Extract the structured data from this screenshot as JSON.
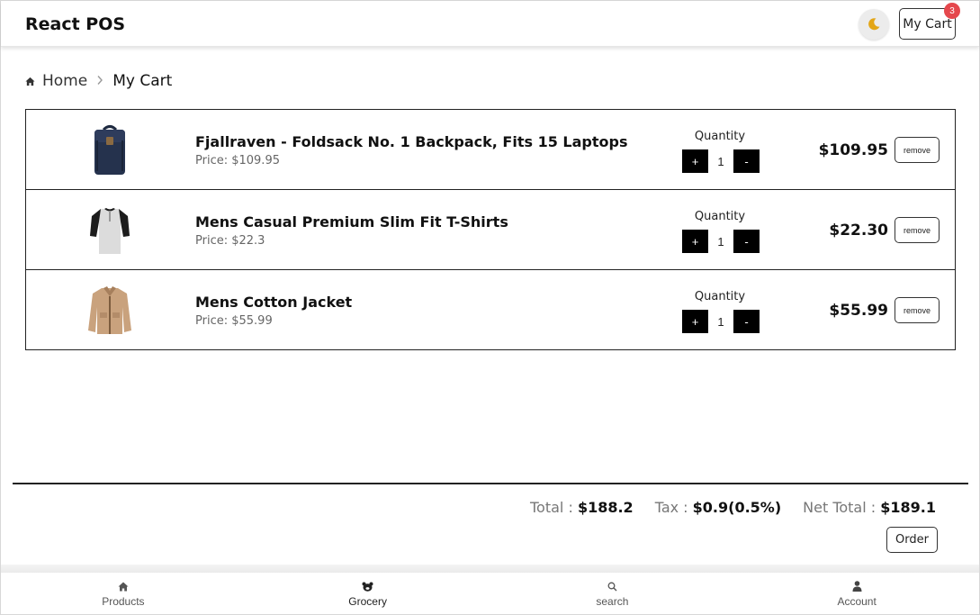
{
  "app": {
    "title": "React POS"
  },
  "header": {
    "cart_label": "My Cart",
    "cart_count": "3",
    "theme_icon": "moon-icon",
    "moon_color": "#e3a617",
    "badge_color": "#e5484d"
  },
  "breadcrumb": {
    "home": "Home",
    "separator": ">",
    "current": "My Cart"
  },
  "cart": {
    "quantity_label": "Quantity",
    "plus": "+",
    "minus": "-",
    "remove_label": "remove",
    "items": [
      {
        "title": "Fjallraven - Foldsack No. 1 Backpack, Fits 15 Laptops",
        "price": "Price: $109.95",
        "qty": "1",
        "total": "$109.95",
        "image": "backpack-image"
      },
      {
        "title": "Mens Casual Premium Slim Fit T-Shirts",
        "price": "Price: $22.3",
        "qty": "1",
        "total": "$22.30",
        "image": "tshirt-image"
      },
      {
        "title": "Mens Cotton Jacket",
        "price": "Price: $55.99",
        "qty": "1",
        "total": "$55.99",
        "image": "jacket-image"
      }
    ]
  },
  "summary": {
    "total_label": "Total : ",
    "total_value": "$188.2",
    "tax_label": "Tax : ",
    "tax_value": "$0.9(0.5%)",
    "net_label": "Net Total : ",
    "net_value": "$189.1",
    "order_label": "Order"
  },
  "bottom_nav": [
    {
      "label": "Products",
      "icon": "home-icon"
    },
    {
      "label": "Grocery",
      "icon": "bear-icon"
    },
    {
      "label": "search",
      "icon": "search-icon"
    },
    {
      "label": "Account",
      "icon": "user-icon"
    }
  ]
}
